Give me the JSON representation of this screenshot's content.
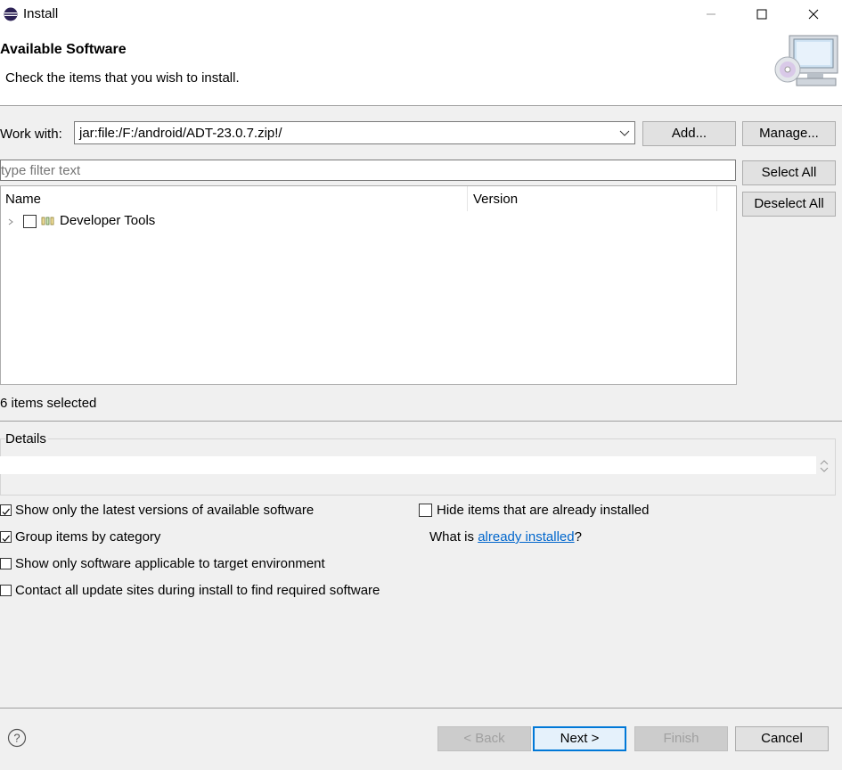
{
  "window": {
    "title": "Install",
    "icon": "eclipse-icon",
    "controls": [
      "minimize-icon",
      "maximize-icon",
      "close-icon"
    ]
  },
  "header": {
    "title": "Available Software",
    "subtitle": "Check the items that you wish to install.",
    "image": "install-cd-monitor-icon"
  },
  "work_with": {
    "label": "Work with:",
    "value": "jar:file:/F:/android/ADT-23.0.7.zip!/",
    "add_label": "Add...",
    "manage_label": "Manage..."
  },
  "filter": {
    "placeholder": "type filter text"
  },
  "side_buttons": {
    "select_all": "Select All",
    "deselect_all": "Deselect All"
  },
  "table": {
    "columns": [
      "Name",
      "Version"
    ],
    "rows": [
      {
        "label": "Developer Tools",
        "version": "",
        "checked": false,
        "expanded": false
      }
    ]
  },
  "selected_count": "6 items selected",
  "details": {
    "legend": "Details",
    "text": ""
  },
  "options": {
    "latest_versions": {
      "label": "Show only the latest versions of available software",
      "checked": true
    },
    "group_by_category": {
      "label": "Group items by category",
      "checked": true
    },
    "applicable_only": {
      "label": "Show only software applicable to target environment",
      "checked": false
    },
    "contact_sites": {
      "label": "Contact all update sites during install to find required software",
      "checked": false
    },
    "hide_installed": {
      "label": "Hide items that are already installed",
      "checked": false
    }
  },
  "what_installed": {
    "prefix": "What is ",
    "link": "already installed",
    "suffix": "?"
  },
  "footer": {
    "back": "< Back",
    "next": "Next >",
    "finish": "Finish",
    "cancel": "Cancel"
  },
  "colors": {
    "link": "#0066cc",
    "focus_border": "#0078d7",
    "dialog_bg": "#f0f0f0"
  }
}
